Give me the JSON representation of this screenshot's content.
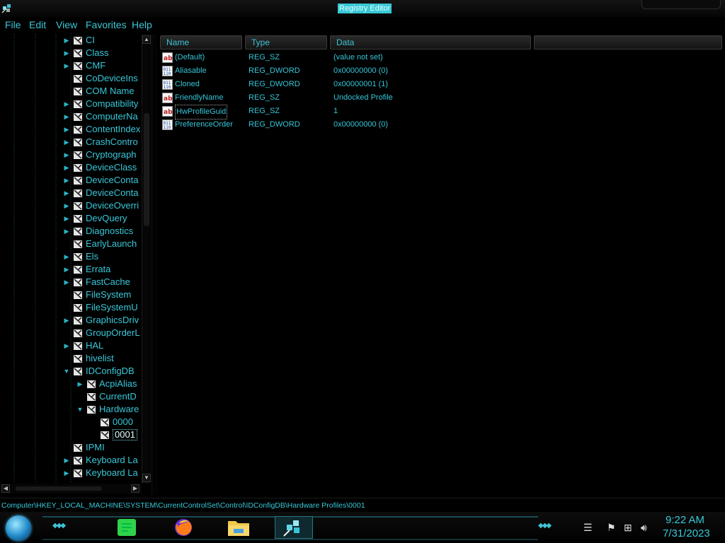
{
  "window": {
    "title": "Registry Editor"
  },
  "menu": [
    "File",
    "Edit",
    "View",
    "Favorites",
    "Help"
  ],
  "tree": {
    "items": [
      {
        "label": "CI",
        "depth": 0,
        "expander": "arrow"
      },
      {
        "label": "Class",
        "depth": 0,
        "expander": "arrow"
      },
      {
        "label": "CMF",
        "depth": 0,
        "expander": "arrow"
      },
      {
        "label": "CoDeviceIns",
        "depth": 0,
        "expander": "none"
      },
      {
        "label": "COM Name",
        "depth": 0,
        "expander": "none"
      },
      {
        "label": "Compatibility",
        "depth": 0,
        "expander": "arrow"
      },
      {
        "label": "ComputerNa",
        "depth": 0,
        "expander": "arrow"
      },
      {
        "label": "ContentIndex",
        "depth": 0,
        "expander": "arrow"
      },
      {
        "label": "CrashContro",
        "depth": 0,
        "expander": "arrow"
      },
      {
        "label": "Cryptograph",
        "depth": 0,
        "expander": "arrow"
      },
      {
        "label": "DeviceClass",
        "depth": 0,
        "expander": "arrow"
      },
      {
        "label": "DeviceConta",
        "depth": 0,
        "expander": "arrow"
      },
      {
        "label": "DeviceConta",
        "depth": 0,
        "expander": "arrow"
      },
      {
        "label": "DeviceOverri",
        "depth": 0,
        "expander": "arrow"
      },
      {
        "label": "DevQuery",
        "depth": 0,
        "expander": "arrow"
      },
      {
        "label": "Diagnostics",
        "depth": 0,
        "expander": "arrow"
      },
      {
        "label": "EarlyLaunch",
        "depth": 0,
        "expander": "none"
      },
      {
        "label": "Els",
        "depth": 0,
        "expander": "arrow"
      },
      {
        "label": "Errata",
        "depth": 0,
        "expander": "arrow"
      },
      {
        "label": "FastCache",
        "depth": 0,
        "expander": "arrow"
      },
      {
        "label": "FileSystem",
        "depth": 0,
        "expander": "none"
      },
      {
        "label": "FileSystemU",
        "depth": 0,
        "expander": "none"
      },
      {
        "label": "GraphicsDriv",
        "depth": 0,
        "expander": "arrow"
      },
      {
        "label": "GroupOrderL",
        "depth": 0,
        "expander": "none"
      },
      {
        "label": "HAL",
        "depth": 0,
        "expander": "arrow"
      },
      {
        "label": "hivelist",
        "depth": 0,
        "expander": "none"
      },
      {
        "label": "IDConfigDB",
        "depth": 0,
        "expander": "open"
      },
      {
        "label": "AcpiAlias",
        "depth": 1,
        "expander": "arrow"
      },
      {
        "label": "CurrentD",
        "depth": 1,
        "expander": "none"
      },
      {
        "label": "Hardware",
        "depth": 1,
        "expander": "open"
      },
      {
        "label": "0000",
        "depth": 2,
        "expander": "none"
      },
      {
        "label": "0001",
        "depth": 2,
        "expander": "none",
        "selected": true
      },
      {
        "label": "IPMI",
        "depth": 0,
        "expander": "none"
      },
      {
        "label": "Keyboard La",
        "depth": 0,
        "expander": "arrow"
      },
      {
        "label": "Keyboard La",
        "depth": 0,
        "expander": "arrow"
      }
    ]
  },
  "columns": {
    "name": "Name",
    "type": "Type",
    "data": "Data"
  },
  "values": [
    {
      "name": "(Default)",
      "type": "REG_SZ",
      "data": "(value not set)",
      "icon": "string-value-icon"
    },
    {
      "name": "Aliasable",
      "type": "REG_DWORD",
      "data": "0x00000000 (0)",
      "icon": "binary-value-icon"
    },
    {
      "name": "Cloned",
      "type": "REG_DWORD",
      "data": "0x00000001 (1)",
      "icon": "binary-value-icon"
    },
    {
      "name": "FriendlyName",
      "type": "REG_SZ",
      "data": "Undocked Profile",
      "icon": "string-value-icon"
    },
    {
      "name": "HwProfileGuid",
      "type": "REG_SZ",
      "data": "1",
      "icon": "string-value-icon",
      "focused": true
    },
    {
      "name": "PreferenceOrder",
      "type": "REG_DWORD",
      "data": "0x00000000 (0)",
      "icon": "binary-value-icon"
    }
  ],
  "status": {
    "path": "Computer\\HKEY_LOCAL_MACHINE\\SYSTEM\\CurrentControlSet\\Control\\IDConfigDB\\Hardware Profiles\\0001"
  },
  "taskbar": {
    "apps": [
      "notes-app-icon",
      "firefox-icon",
      "file-explorer-icon",
      "registry-editor-icon"
    ],
    "active_app": "registry-editor-icon",
    "time": "9:22 AM",
    "date": "7/31/2023"
  },
  "colors": {
    "accent": "#38c8d8",
    "background": "#000000",
    "title_highlight": "#38c8d6"
  }
}
